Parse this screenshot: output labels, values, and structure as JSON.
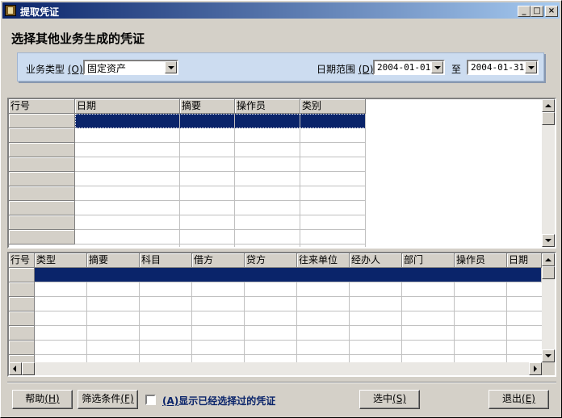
{
  "window": {
    "title": "提取凭证",
    "min": "_",
    "max": "□",
    "close": "×"
  },
  "heading": "选择其他业务生成的凭证",
  "filter": {
    "type_label": "业务类型",
    "type_hotkey": "(O)",
    "type_value": "固定资产",
    "date_label": "日期范围",
    "date_hotkey": "(D)",
    "date_from": "2004-01-01",
    "to_label": "至",
    "date_to": "2004-01-31"
  },
  "upper_grid": {
    "columns": [
      "行号",
      "日期",
      "摘要",
      "操作员",
      "类别"
    ]
  },
  "lower_grid": {
    "columns": [
      "行号",
      "类型",
      "摘要",
      "科目",
      "借方",
      "贷方",
      "往来单位",
      "经办人",
      "部门",
      "操作员",
      "日期"
    ]
  },
  "buttons": {
    "help": "帮助",
    "help_key": "(H)",
    "filter": "筛选条件",
    "filter_key": "(F)",
    "show_selected_key": "(A)",
    "show_selected": "显示已经选择过的凭证",
    "select": "选中",
    "select_key": "(S)",
    "exit": "退出",
    "exit_key": "(E)"
  },
  "colors": {
    "title_bar": "#0a246a",
    "selection": "#0a246a",
    "filter_bg": "#ccdcf0"
  }
}
